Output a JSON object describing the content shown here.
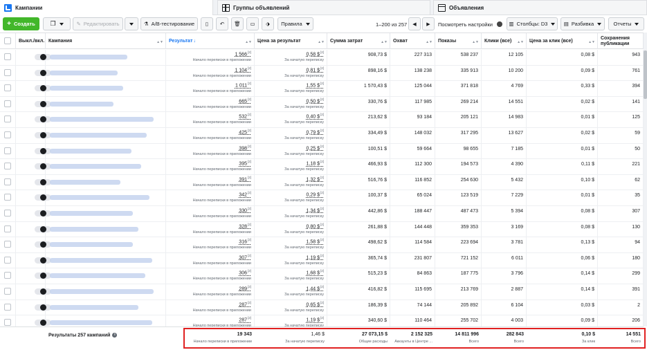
{
  "tabs": {
    "campaigns": "Кампании",
    "adsets": "Группы объявлений",
    "ads": "Объявления"
  },
  "toolbar": {
    "create": "Создать",
    "edit": "Редактировать",
    "ab_test": "A/B-тестирование",
    "rules": "Правила",
    "pagination": "1–200 из 257",
    "view_settings": "Посмотреть настройки",
    "columns": "Столбцы: D3",
    "breakdown": "Разбивка",
    "reports": "Отчеты"
  },
  "columns": {
    "toggle": "Выкл./вкл.",
    "campaign": "Кампания",
    "result": "Результат",
    "cost_per_result": "Цена за результат",
    "spend": "Сумма затрат",
    "reach": "Охват",
    "impressions": "Показы",
    "clicks": "Клики (все)",
    "cpc": "Цена за клик (все)",
    "saves": "Сохранения публикации"
  },
  "result_sub": "Начало переписки в приложении",
  "cost_sub": "За начатую переписку",
  "rows": [
    {
      "result": "1 566",
      "cost": "0,58 $",
      "spend": "908,73 $",
      "reach": "227 313",
      "impr": "538 237",
      "clicks": "12 105",
      "cpc": "0,08 $",
      "saves": "943"
    },
    {
      "result": "1 104",
      "cost": "0,81 $",
      "spend": "898,16 $",
      "reach": "138 238",
      "impr": "335 913",
      "clicks": "10 200",
      "cpc": "0,09 $",
      "saves": "761"
    },
    {
      "result": "1 011",
      "cost": "1,55 $",
      "spend": "1 570,43 $",
      "reach": "125 044",
      "impr": "371 818",
      "clicks": "4 769",
      "cpc": "0,33 $",
      "saves": "394"
    },
    {
      "result": "665",
      "cost": "0,50 $",
      "spend": "330,76 $",
      "reach": "117 985",
      "impr": "269 214",
      "clicks": "14 551",
      "cpc": "0,02 $",
      "saves": "141"
    },
    {
      "result": "532",
      "cost": "0,40 $",
      "spend": "213,62 $",
      "reach": "93 184",
      "impr": "205 121",
      "clicks": "14 983",
      "cpc": "0,01 $",
      "saves": "125"
    },
    {
      "result": "425",
      "cost": "0,79 $",
      "spend": "334,49 $",
      "reach": "148 032",
      "impr": "317 295",
      "clicks": "13 627",
      "cpc": "0,02 $",
      "saves": "59"
    },
    {
      "result": "398",
      "cost": "0,25 $",
      "spend": "100,51 $",
      "reach": "59 664",
      "impr": "98 655",
      "clicks": "7 185",
      "cpc": "0,01 $",
      "saves": "50"
    },
    {
      "result": "395",
      "cost": "1,18 $",
      "spend": "466,93 $",
      "reach": "112 300",
      "impr": "194 573",
      "clicks": "4 390",
      "cpc": "0,11 $",
      "saves": "221"
    },
    {
      "result": "391",
      "cost": "1,32 $",
      "spend": "516,76 $",
      "reach": "116 852",
      "impr": "254 630",
      "clicks": "5 432",
      "cpc": "0,10 $",
      "saves": "62"
    },
    {
      "result": "342",
      "cost": "0,29 $",
      "spend": "100,37 $",
      "reach": "65 024",
      "impr": "123 519",
      "clicks": "7 229",
      "cpc": "0,01 $",
      "saves": "35"
    },
    {
      "result": "330",
      "cost": "1,34 $",
      "spend": "442,86 $",
      "reach": "188 447",
      "impr": "487 473",
      "clicks": "5 394",
      "cpc": "0,08 $",
      "saves": "307"
    },
    {
      "result": "328",
      "cost": "0,80 $",
      "spend": "261,88 $",
      "reach": "144 448",
      "impr": "359 353",
      "clicks": "3 169",
      "cpc": "0,08 $",
      "saves": "130"
    },
    {
      "result": "316",
      "cost": "1,58 $",
      "spend": "498,62 $",
      "reach": "114 584",
      "impr": "223 694",
      "clicks": "3 781",
      "cpc": "0,13 $",
      "saves": "94"
    },
    {
      "result": "307",
      "cost": "1,19 $",
      "spend": "365,74 $",
      "reach": "231 807",
      "impr": "721 152",
      "clicks": "6 011",
      "cpc": "0,06 $",
      "saves": "180"
    },
    {
      "result": "306",
      "cost": "1,68 $",
      "spend": "515,23 $",
      "reach": "84 863",
      "impr": "187 775",
      "clicks": "3 796",
      "cpc": "0,14 $",
      "saves": "299"
    },
    {
      "result": "289",
      "cost": "1,44 $",
      "spend": "416,82 $",
      "reach": "115 695",
      "impr": "213 769",
      "clicks": "2 887",
      "cpc": "0,14 $",
      "saves": "391"
    },
    {
      "result": "287",
      "cost": "0,65 $",
      "spend": "186,39 $",
      "reach": "74 144",
      "impr": "205 892",
      "clicks": "6 104",
      "cpc": "0,03 $",
      "saves": "2"
    },
    {
      "result": "287",
      "cost": "1,19 $",
      "spend": "340,60 $",
      "reach": "110 464",
      "impr": "255 702",
      "clicks": "4 003",
      "cpc": "0,09 $",
      "saves": "206"
    }
  ],
  "footer": {
    "label": "Результаты 257 кампаний",
    "result": "19 343",
    "result_sub": "Начало переписки в приложении",
    "cost": "1,46 $",
    "cost_sub": "За начатую переписку",
    "spend": "27 073,15 $",
    "spend_sub": "Общие расходы",
    "reach": "2 152 325",
    "reach_sub": "Аккаунты в Центре ...",
    "impr": "14 811 996",
    "impr_sub": "Всего",
    "clicks": "282 843",
    "clicks_sub": "Всего",
    "cpc": "0,10 $",
    "cpc_sub": "За клик",
    "saves": "14 551",
    "saves_sub": "Всего"
  }
}
